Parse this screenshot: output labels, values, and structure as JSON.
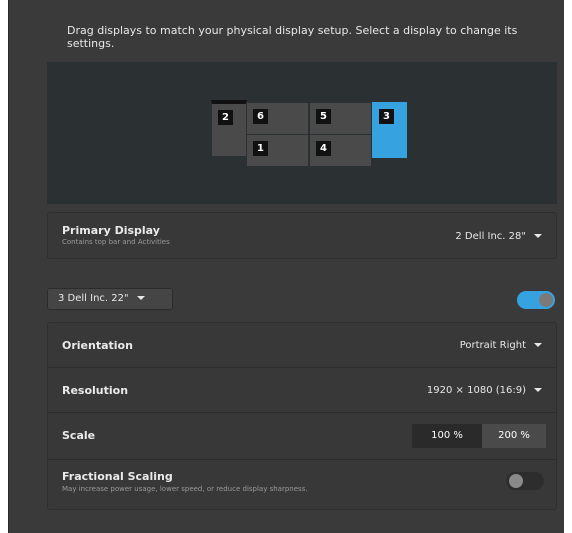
{
  "intro_text": "Drag displays to match your physical display setup. Select a display to change its settings.",
  "monitors": [
    {
      "number": "2"
    },
    {
      "number": "6"
    },
    {
      "number": "1"
    },
    {
      "number": "5"
    },
    {
      "number": "4"
    },
    {
      "number": "3"
    }
  ],
  "primary_display": {
    "label": "Primary Display",
    "subtitle": "Contains top bar and Activities",
    "value": "2   Dell Inc. 28\""
  },
  "display_selector": {
    "value": "3   Dell Inc. 22\""
  },
  "display_enabled": true,
  "settings": {
    "orientation": {
      "label": "Orientation",
      "value": "Portrait Right"
    },
    "resolution": {
      "label": "Resolution",
      "value": "1920 × 1080 (16:9)"
    },
    "scale": {
      "label": "Scale",
      "options": [
        "100 %",
        "200 %"
      ],
      "selected": "100 %"
    },
    "fractional_scaling": {
      "label": "Fractional Scaling",
      "subtitle": "May increase power usage, lower speed, or reduce display sharpness.",
      "enabled": false
    }
  },
  "colors": {
    "accent": "#36a3e0",
    "panel_bg": "#3a3a3a",
    "arrangement_bg": "#2b3033"
  }
}
